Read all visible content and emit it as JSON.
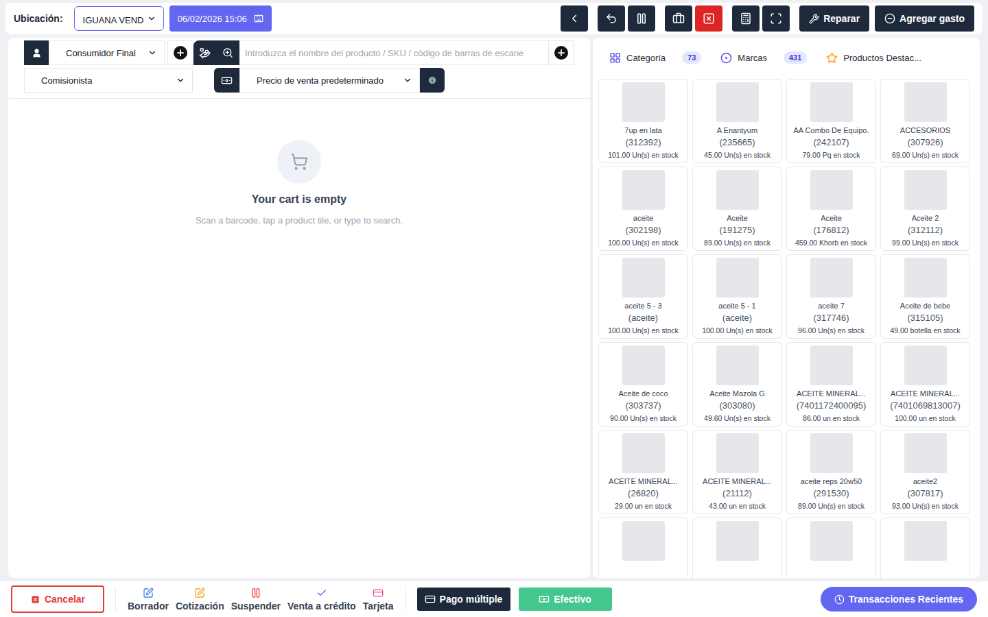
{
  "top_bar": {
    "location_label": "Ubicación:",
    "location_value": "IGUANA VEND",
    "datetime": "06/02/2026 15:06",
    "icon_buttons": [
      {
        "color": "#1e293b"
      },
      {
        "color": "#1e293b"
      },
      {
        "color": "#1e293b"
      },
      {
        "color": "#1e293b"
      },
      {
        "color": "#dc2626"
      },
      {
        "color": "#1e293b"
      },
      {
        "color": "#1e293b"
      }
    ],
    "actions": [
      {
        "label": "Reparar"
      },
      {
        "label": "Agregar gasto"
      }
    ]
  },
  "customer": {
    "value": "Consumidor Final"
  },
  "search": {
    "placeholder": "Introduzca el nombre del producto / SKU / código de barras de escane"
  },
  "commission_agent": {
    "value": "Comisionista"
  },
  "price_group": {
    "value": "Precio de venta predeterminado"
  },
  "cart": {
    "title": "Your cart is empty",
    "hint": "Scan a barcode, tap a product tile, or type to search."
  },
  "tabs": [
    {
      "label": "Categoría",
      "count": "73",
      "selected": false
    },
    {
      "label": "Marcas",
      "count": "431",
      "selected": false
    },
    {
      "label": "Productos Destac...",
      "count": "",
      "selected": false
    }
  ],
  "products": [
    {
      "name": "7up en lata",
      "code": "(312392)",
      "stock": "101.00 Un(s) en stock"
    },
    {
      "name": "A Enantyum",
      "code": "(235665)",
      "stock": "45.00 Un(s) en stock"
    },
    {
      "name": "AA Combo De Equipo.",
      "code": "(242107)",
      "stock": "79.00 Pq en stock"
    },
    {
      "name": "ACCESORIOS",
      "code": "(307926)",
      "stock": "69.00 Un(s) en stock"
    },
    {
      "name": "aceite",
      "code": "(302198)",
      "stock": "100.00 Un(s) en stock"
    },
    {
      "name": "Aceite",
      "code": "(191275)",
      "stock": "89.00 Un(s) en stock"
    },
    {
      "name": "Aceite",
      "code": "(176812)",
      "stock": "459.00 Khorb en stock"
    },
    {
      "name": "Aceite 2",
      "code": "(312112)",
      "stock": "99.00 Un(s) en stock"
    },
    {
      "name": "aceite 5 - 3",
      "code": "(aceite)",
      "stock": "100.00 Un(s) en stock"
    },
    {
      "name": "aceite 5 - 1",
      "code": "(aceite)",
      "stock": "100.00 Un(s) en stock"
    },
    {
      "name": "aceite 7",
      "code": "(317746)",
      "stock": "96.00 Un(s) en stock"
    },
    {
      "name": "Aceite de bebe",
      "code": "(315105)",
      "stock": "49.00 botella en stock"
    },
    {
      "name": "Aceite de coco",
      "code": "(303737)",
      "stock": "90.00 Un(s) en stock"
    },
    {
      "name": "Aceite Mazola G",
      "code": "(303080)",
      "stock": "49.60 Un(s) en stock"
    },
    {
      "name": "ACEITE MINERAL...",
      "code": "(7401172400095)",
      "stock": "86.00 un en stock"
    },
    {
      "name": "ACEITE MINERAL...",
      "code": "(7401069813007)",
      "stock": "100.00 un en stock"
    },
    {
      "name": "ACEITE MINERAL...",
      "code": "(26820)",
      "stock": "29.00 un en stock"
    },
    {
      "name": "ACEITE MINERAL...",
      "code": "(21112)",
      "stock": "43.00 un en stock"
    },
    {
      "name": "aceite reps 20w50",
      "code": "(291530)",
      "stock": "89.00 Un(s) en stock"
    },
    {
      "name": "aceite2",
      "code": "(307817)",
      "stock": "93.00 Un(s) en stock"
    },
    {
      "name": "",
      "code": "",
      "stock": ""
    },
    {
      "name": "",
      "code": "",
      "stock": ""
    },
    {
      "name": "",
      "code": "",
      "stock": ""
    },
    {
      "name": "",
      "code": "",
      "stock": ""
    }
  ],
  "footer": {
    "cancel": "Cancelar",
    "actions": [
      {
        "label": "Borrador",
        "color": "#3b82f6"
      },
      {
        "label": "Cotización",
        "color": "#f5a623"
      },
      {
        "label": "Suspender",
        "color": "#ef4444"
      },
      {
        "label": "Venta a crédito",
        "color": "#6366f1"
      },
      {
        "label": "Tarjeta",
        "color": "#ec4899"
      }
    ],
    "multi_pay": "Pago múltiple",
    "cash": "Efectivo",
    "recent": "Transacciones Recientes"
  }
}
